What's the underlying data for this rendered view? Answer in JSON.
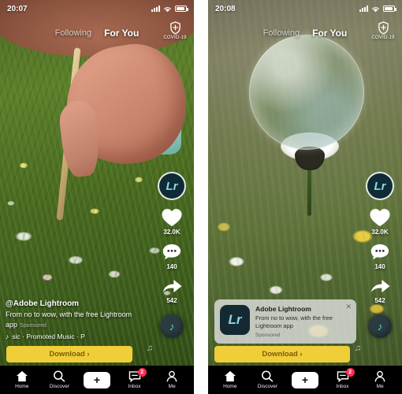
{
  "screens": [
    {
      "status": {
        "time": "20:07",
        "wifi_icon": "wifi-icon",
        "battery_icon": "battery-icon",
        "signal_icon": "signal-bars-icon"
      },
      "topnav": {
        "following": "Following",
        "for_you": "For You",
        "covid_label": "COVID-19",
        "covid_icon": "shield-icon"
      },
      "rail": {
        "avatar_label": "Lr",
        "like_icon": "heart-icon",
        "like_count": "32.0K",
        "comment_icon": "comment-icon",
        "comment_count": "140",
        "share_icon": "share-arrow-icon",
        "share_count": "542",
        "disc_icon": "music-note-disc-icon"
      },
      "caption": {
        "username": "@Adobe Lightroom",
        "text": "From no to wow, with the free Lightroom app",
        "sponsored": "Sponsored",
        "music_icon": "music-note-icon",
        "music_ticker": "sic · Promoted Music · P"
      },
      "cta": {
        "label": "Download",
        "chevron": "›"
      }
    },
    {
      "status": {
        "time": "20:08",
        "wifi_icon": "wifi-icon",
        "battery_icon": "battery-icon",
        "signal_icon": "signal-bars-icon"
      },
      "topnav": {
        "following": "Following",
        "for_you": "For You",
        "covid_label": "COVID-19",
        "covid_icon": "shield-icon"
      },
      "rail": {
        "avatar_label": "Lr",
        "like_icon": "heart-icon",
        "like_count": "32.0K",
        "comment_icon": "comment-icon",
        "comment_count": "140",
        "share_icon": "share-arrow-icon",
        "share_count": "542",
        "disc_icon": "music-note-disc-icon"
      },
      "ad_card": {
        "app_icon_label": "Lr",
        "title": "Adobe Lightroom",
        "description": "From no to wow, with the free Lightroom app",
        "sponsored": "Sponsored",
        "close_icon": "close-icon"
      },
      "cta": {
        "label": "Download",
        "chevron": "›"
      }
    }
  ],
  "bottomnav": {
    "items": [
      {
        "icon": "home-icon",
        "label": "Home"
      },
      {
        "icon": "search-icon",
        "label": "Discover"
      },
      {
        "icon": "plus-icon",
        "label": ""
      },
      {
        "icon": "inbox-message-icon",
        "label": "Inbox",
        "badge": "2"
      },
      {
        "icon": "person-icon",
        "label": "Me"
      }
    ]
  },
  "colors": {
    "accent_yellow": "#f0ce3a",
    "badge_red": "#fe2c55",
    "cyan": "#25f4ee",
    "lr_blue": "#8fd4e8"
  }
}
